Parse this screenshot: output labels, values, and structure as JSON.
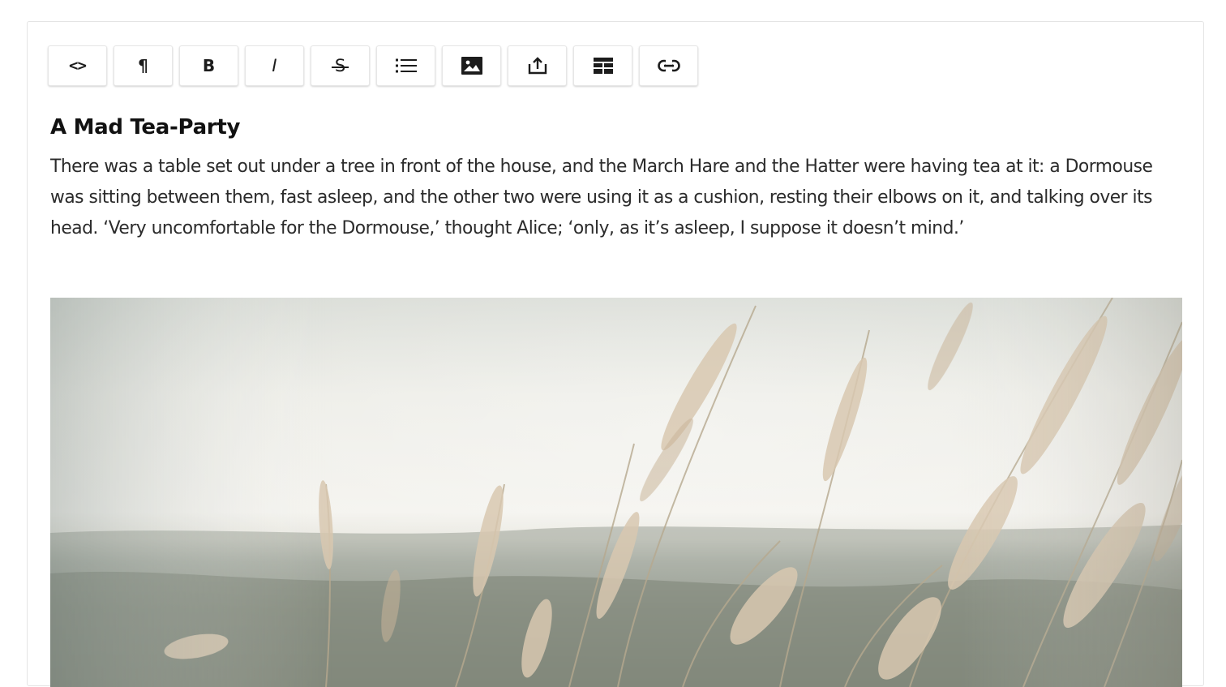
{
  "toolbar": {
    "buttons": [
      {
        "icon": "code-icon",
        "glyph": "<>"
      },
      {
        "icon": "paragraph-icon",
        "glyph": "¶"
      },
      {
        "icon": "bold-icon",
        "glyph": "B"
      },
      {
        "icon": "italic-icon",
        "glyph": "I"
      },
      {
        "icon": "strikethrough-icon",
        "glyph": "S"
      },
      {
        "icon": "list-icon",
        "glyph": ""
      },
      {
        "icon": "image-icon",
        "glyph": ""
      },
      {
        "icon": "upload-icon",
        "glyph": ""
      },
      {
        "icon": "table-icon",
        "glyph": ""
      },
      {
        "icon": "link-icon",
        "glyph": ""
      }
    ]
  },
  "document": {
    "heading": "A Mad Tea-Party",
    "paragraph": "There was a table set out under a tree in front of the house, and the March Hare and the Hatter were having tea at it: a Dormouse was sitting between them, fast asleep, and the other two were using it as a cushion, resting their elbows on it, and talking over its head. ‘Very uncomfortable for the Dormouse,’ thought Alice; ‘only, as it’s asleep, I suppose it doesn’t mind.’"
  },
  "colors": {
    "text": "#2b2b2b",
    "heading": "#111111",
    "border": "#e4e4e4",
    "sky": "#f2f1ec",
    "grass": "#c9b59a"
  }
}
